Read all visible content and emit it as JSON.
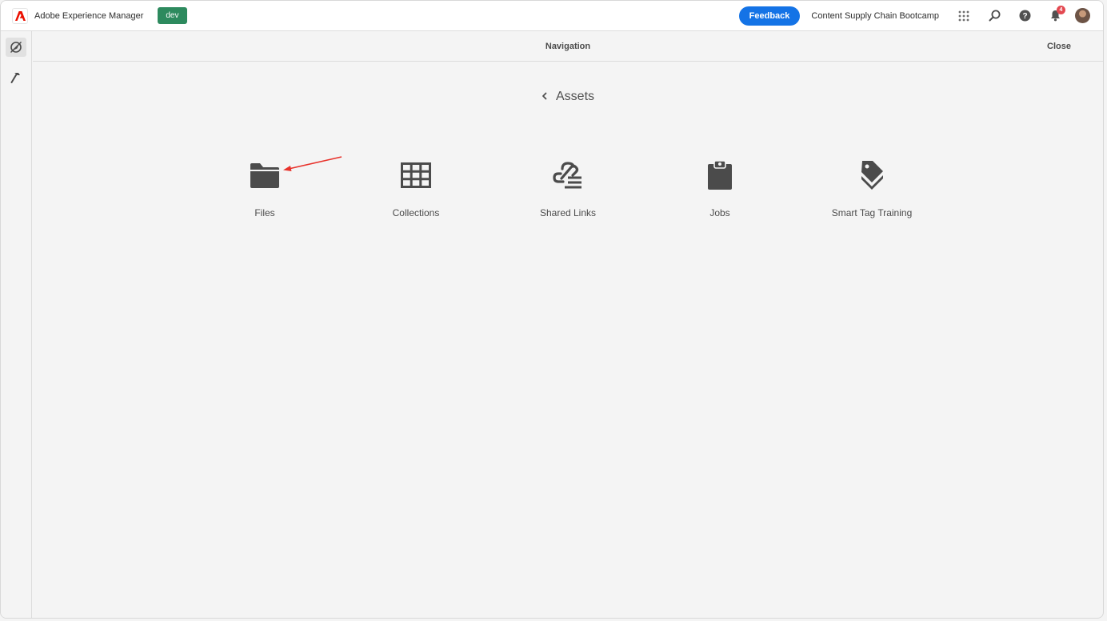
{
  "header": {
    "product_name": "Adobe Experience Manager",
    "env_badge": "dev",
    "feedback_label": "Feedback",
    "org_name": "Content Supply Chain Bootcamp",
    "notification_count": "4"
  },
  "nav": {
    "title": "Navigation",
    "close_label": "Close"
  },
  "breadcrumb": {
    "label": "Assets"
  },
  "tiles": [
    {
      "label": "Files",
      "icon": "folder-icon"
    },
    {
      "label": "Collections",
      "icon": "grid-icon"
    },
    {
      "label": "Shared Links",
      "icon": "link-list-icon"
    },
    {
      "label": "Jobs",
      "icon": "clipboard-icon"
    },
    {
      "label": "Smart Tag Training",
      "icon": "tags-icon"
    }
  ],
  "colors": {
    "accent": "#1473e6",
    "env_badge": "#2d8a5e",
    "adobe_red": "#eb1000",
    "annotation_arrow": "#e8322b",
    "icon_gray": "#4b4b4b"
  }
}
